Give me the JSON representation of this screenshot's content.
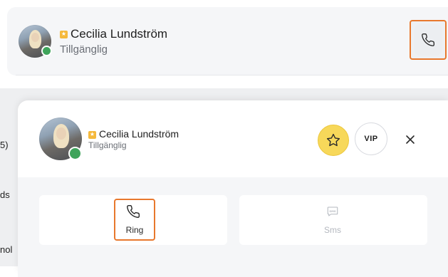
{
  "contact": {
    "name": "Cecilia Lundström",
    "status": "Tillgänglig",
    "status_color": "#3fa45b",
    "vip_badge_color": "#f5b93c"
  },
  "background_fragments": [
    "5)",
    "ds",
    "nol"
  ],
  "modal": {
    "name": "Cecilia Lundström",
    "status": "Tillgänglig",
    "vip_label": "VIP",
    "close_icon": "close-icon",
    "favorite_color": "#f7d85a",
    "actions": [
      {
        "label": "Ring",
        "icon": "phone-icon",
        "enabled": true
      },
      {
        "label": "Sms",
        "icon": "sms-icon",
        "enabled": false
      }
    ]
  },
  "highlight_color": "#e8782d"
}
